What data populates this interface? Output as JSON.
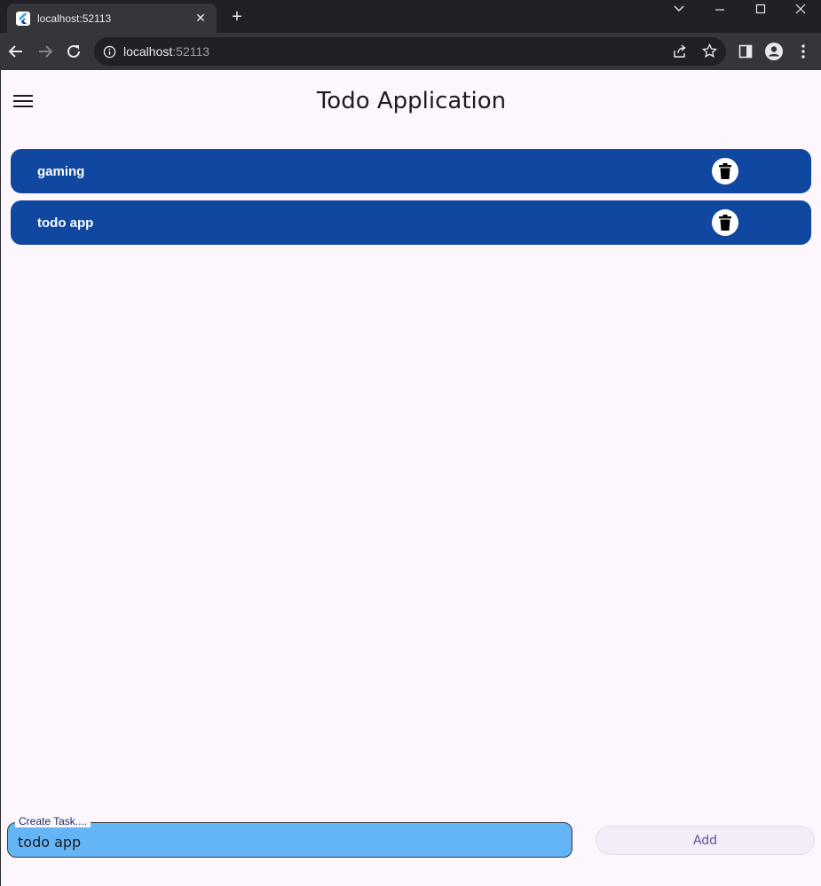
{
  "browser": {
    "tab_title": "localhost:52113",
    "tab_close": "✕",
    "new_tab": "+",
    "url_host": "localhost",
    "url_port": ":52113",
    "icons": [
      "flutter-favicon",
      "back-icon",
      "forward-icon",
      "reload-icon",
      "info-icon",
      "share-icon",
      "star-icon",
      "sidepanel-icon",
      "profile-icon",
      "kebab-menu-icon",
      "tab-search-icon",
      "minimize-icon",
      "maximize-icon",
      "close-icon"
    ]
  },
  "app": {
    "title": "Todo Application",
    "primary_color": "#0f47a1",
    "input_color": "#64b5f6",
    "todos": [
      {
        "text": "gaming"
      },
      {
        "text": "todo app"
      }
    ],
    "input": {
      "label": "Create Task....",
      "value": "todo app"
    },
    "add_label": "Add"
  }
}
